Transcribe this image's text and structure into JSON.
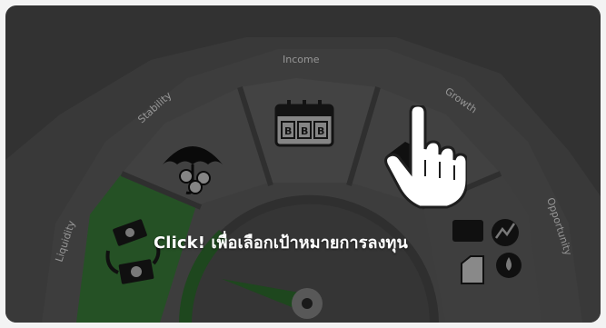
{
  "gauge": {
    "segments": [
      {
        "id": "liquidity",
        "label": "Liquidity",
        "active": true
      },
      {
        "id": "stability",
        "label": "Stability",
        "active": false
      },
      {
        "id": "income",
        "label": "Income",
        "active": false
      },
      {
        "id": "growth",
        "label": "Growth",
        "active": false
      },
      {
        "id": "opportunity",
        "label": "Opportunity",
        "active": false
      }
    ],
    "active_segment": "Liquidity"
  },
  "overlay": {
    "cta_text": "Click! เพื่อเลือกเป้าหมายการลงทุน"
  },
  "colors": {
    "active_green": "#3e8a3e",
    "inner_green": "#2f6f2f",
    "segment_gray": "#6e6e6e",
    "outer_gray": "#5b5b5b",
    "card": "#4f4f4f"
  },
  "icons": {
    "liquidity": "money-cycle-icon",
    "stability": "umbrella-coins-icon",
    "income": "calendar-bonds-icon",
    "growth": "growth-icon",
    "opportunity": "opportunity-icon",
    "pointer": "hand-pointer-icon"
  }
}
